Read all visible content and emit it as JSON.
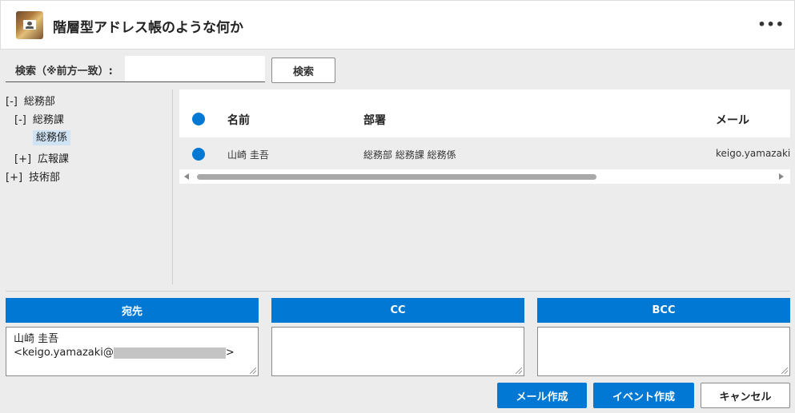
{
  "header": {
    "app_title": "階層型アドレス帳のような何か",
    "more_label": "•••"
  },
  "search": {
    "label": "検索（※前方一致）:",
    "value": "",
    "placeholder": "",
    "button_label": "検索"
  },
  "tree": {
    "nodes": [
      {
        "toggle": "[-]",
        "label": "総務部"
      },
      {
        "toggle": "[-]",
        "label": "総務課"
      },
      {
        "toggle": "",
        "label": "総務係"
      },
      {
        "toggle": "[+]",
        "label": "広報課"
      },
      {
        "toggle": "[+]",
        "label": "技術部"
      }
    ]
  },
  "grid": {
    "columns": [
      "名前",
      "部署",
      "メール"
    ],
    "rows": [
      {
        "name": "山崎 圭吾",
        "dept": "総務部 総務課 総務係",
        "email": "keigo.yamazaki@"
      }
    ],
    "scrollbar_progress": 0.0
  },
  "recipients": {
    "to_label": "宛先",
    "cc_label": "CC",
    "bcc_label": "BCC",
    "to_name": "山崎 圭吾",
    "to_email_prefix": "<keigo.yamazaki@",
    "to_email_suffix": ">",
    "cc_value": "",
    "bcc_value": ""
  },
  "actions": {
    "create_mail": "メール作成",
    "create_event": "イベント作成",
    "cancel": "キャンセル"
  },
  "colors": {
    "accent": "#0078d4",
    "selected_bg": "#cfe3f5"
  }
}
